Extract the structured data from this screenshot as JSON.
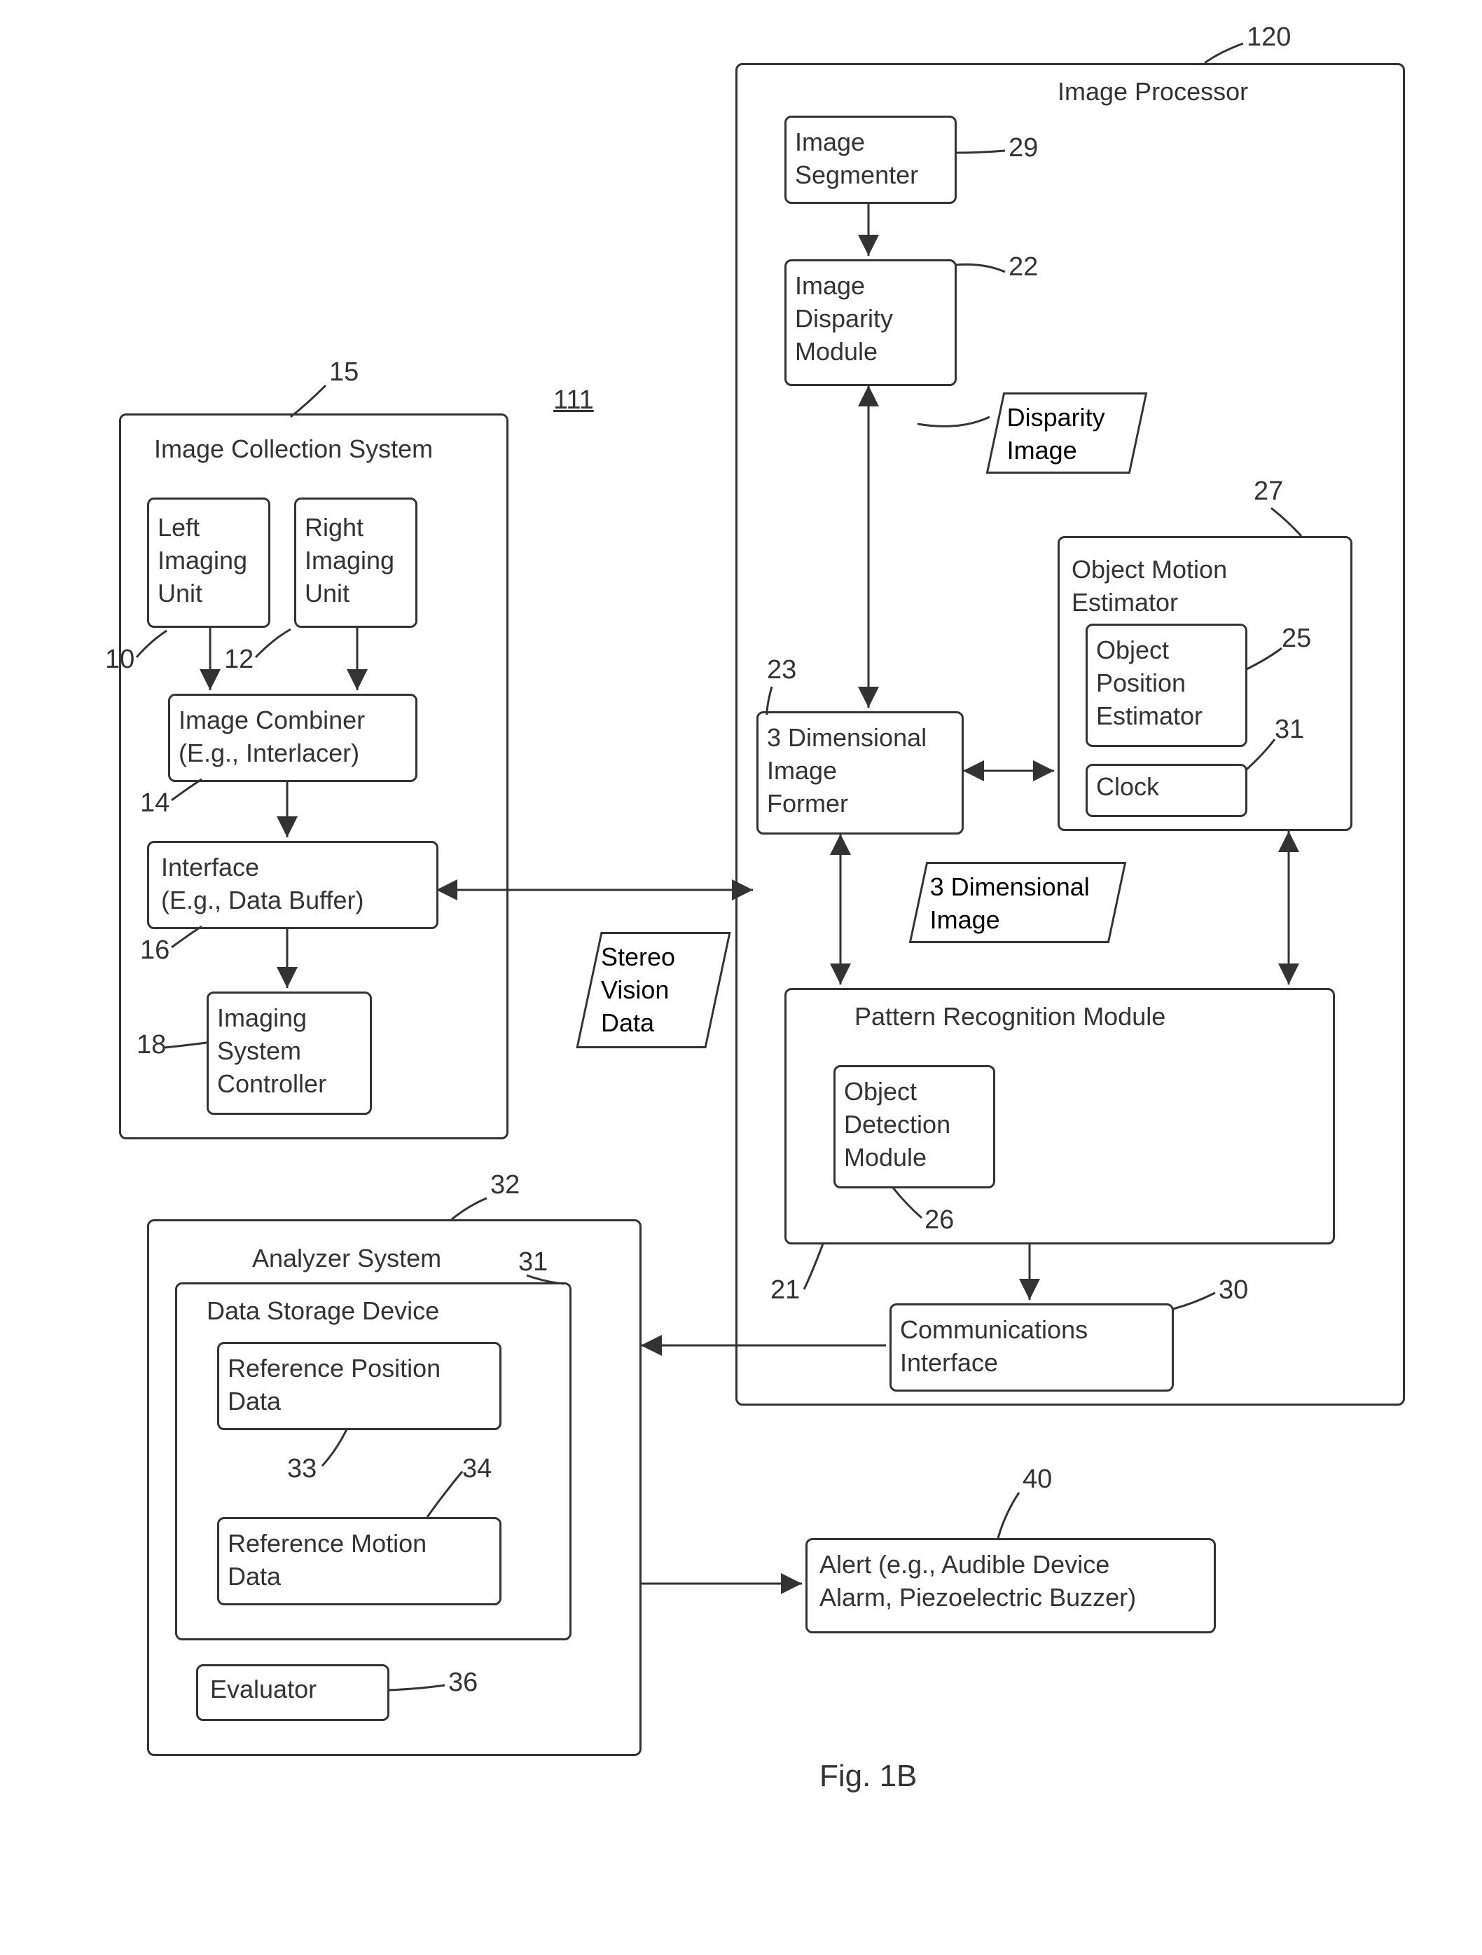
{
  "figure_title": "Fig. 1B",
  "ref_111": "111",
  "image_collection": {
    "title": "Image Collection System",
    "ref": "15",
    "left_imaging": "Left\nImaging\nUnit",
    "left_ref": "10",
    "right_imaging": "Right\nImaging\nUnit",
    "right_ref": "12",
    "combiner": "Image Combiner\n(E.g., Interlacer)",
    "combiner_ref": "14",
    "interface": "Interface\n(E.g., Data Buffer)",
    "interface_ref": "16",
    "controller": "Imaging\nSystem\nController",
    "controller_ref": "18"
  },
  "stereo_vision_data": "Stereo\nVision\nData",
  "image_processor": {
    "title": "Image Processor",
    "ref": "120",
    "segmenter": "Image\nSegmenter",
    "segmenter_ref": "29",
    "disparity": "Image\nDisparity\nModule",
    "disparity_ref": "22",
    "disparity_image": "Disparity\nImage",
    "former": "3 Dimensional\nImage\nFormer",
    "former_ref": "23",
    "three_d_image": "3 Dimensional\nImage",
    "object_motion": "Object Motion\nEstimator",
    "object_motion_ref": "27",
    "object_position": "Object\nPosition\nEstimator",
    "object_position_ref": "25",
    "clock": "Clock",
    "clock_ref": "31",
    "pattern": "Pattern Recognition Module",
    "pattern_ref": "21",
    "object_detection": "Object\nDetection\nModule",
    "object_detection_ref": "26",
    "comms": "Communications\nInterface",
    "comms_ref": "30"
  },
  "analyzer": {
    "title": "Analyzer System",
    "ref": "32",
    "storage": "Data Storage Device",
    "storage_ref": "31",
    "ref_pos": "Reference Position\nData",
    "ref_pos_ref": "33",
    "ref_motion": "Reference Motion\nData",
    "ref_motion_ref": "34",
    "evaluator": "Evaluator",
    "evaluator_ref": "36"
  },
  "alert": {
    "text": "Alert (e.g., Audible Device\nAlarm, Piezoelectric Buzzer)",
    "ref": "40"
  }
}
